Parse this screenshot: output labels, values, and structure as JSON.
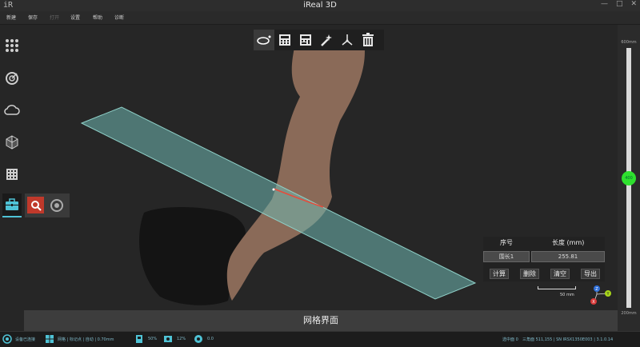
{
  "window": {
    "logo": "iR",
    "title": "iReal 3D",
    "controls": [
      "—",
      "□",
      "✕"
    ]
  },
  "menu": [
    {
      "label": "新建",
      "enabled": true
    },
    {
      "label": "保存",
      "enabled": true
    },
    {
      "label": "打开",
      "enabled": false
    },
    {
      "label": "设置",
      "enabled": true
    },
    {
      "label": "帮助",
      "enabled": true
    },
    {
      "label": "诊断",
      "enabled": true
    }
  ],
  "left_tools": [
    "grid-dots-icon",
    "scan-icon",
    "cloud-icon",
    "mesh-cube-icon",
    "calculator-icon",
    "toolbox-icon"
  ],
  "sub_tools": [
    "search-icon",
    "target-icon"
  ],
  "top_toolbar": [
    "ring-measure-icon",
    "calculator-icon",
    "calculator-alt-icon",
    "magic-wand-icon",
    "axis-icon",
    "trash-icon"
  ],
  "measurement": {
    "col_index": "序号",
    "col_length": "长度 (mm)",
    "rows": [
      {
        "name": "围长1",
        "value": "255.81"
      }
    ],
    "buttons": [
      "计算",
      "删除",
      "清空",
      "导出"
    ]
  },
  "scale_bar": "50 mm",
  "axis_labels": {
    "x": "X",
    "y": "Y",
    "z": "Z"
  },
  "bottom_label": "网格界面",
  "slider": {
    "max_label": "600mm",
    "min_label": "200mm",
    "value": "400",
    "fraction": 0.5
  },
  "status": {
    "device": "设备已连接",
    "mode": "网格 | 标记点 | 自动 | 0.70mm",
    "val1": "50%",
    "val2": "12%",
    "val3": "0.0",
    "right1": "选中面 0",
    "right2": "三角面 511,155 | SN IRSX1350E003 | 3.1.0.14"
  },
  "colors": {
    "accent": "#4fc3d6",
    "plane": "#6fb8b2",
    "slider_knob": "#2ee02e",
    "measure_line": "#e84a3a"
  }
}
